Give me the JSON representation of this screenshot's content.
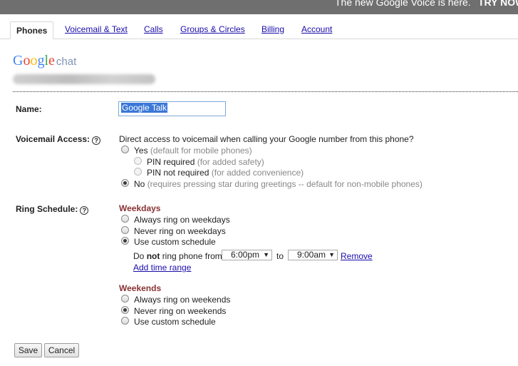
{
  "topbar": {
    "promo_text": "The new Google Voice is here.",
    "promo_cta": "TRY NOW"
  },
  "tabs": [
    {
      "label": "Phones",
      "active": true
    },
    {
      "label": "Voicemail & Text"
    },
    {
      "label": "Calls"
    },
    {
      "label": "Groups & Circles"
    },
    {
      "label": "Billing"
    },
    {
      "label": "Account"
    }
  ],
  "logo": {
    "google": "Google",
    "product": "chat",
    "colors": [
      "#4285f4",
      "#ea4335",
      "#fbbc05",
      "#4285f4",
      "#34a853",
      "#ea4335"
    ]
  },
  "name_field": {
    "label": "Name:",
    "value": "Google Talk"
  },
  "voicemail": {
    "label": "Voicemail Access:",
    "help_icon": "?",
    "question": "Direct access to voicemail when calling your Google number from this phone?",
    "yes_label": "Yes",
    "yes_note": "(default for mobile phones)",
    "pin_required_label": "PIN required",
    "pin_required_note": "(for added safety)",
    "pin_not_required_label": "PIN not required",
    "pin_not_required_note": "(for added convenience)",
    "no_label": "No",
    "no_note": "(requires pressing star during greetings -- default for non-mobile phones)",
    "selected": "no"
  },
  "ring_schedule": {
    "label": "Ring Schedule:",
    "help_icon": "?",
    "weekdays": {
      "title": "Weekdays",
      "options": [
        "Always ring on weekdays",
        "Never ring on weekdays",
        "Use custom schedule"
      ],
      "selected_index": 2,
      "custom": {
        "prefix_do": "Do",
        "prefix_not": "not",
        "prefix_rest": "ring phone from",
        "from_value": "6:00pm",
        "to_label": "to",
        "to_value": "9:00am",
        "remove_label": "Remove",
        "add_range_label": "Add time range"
      }
    },
    "weekends": {
      "title": "Weekends",
      "options": [
        "Always ring on weekends",
        "Never ring on weekends",
        "Use custom schedule"
      ],
      "selected_index": 1
    }
  },
  "buttons": {
    "save": "Save",
    "cancel": "Cancel"
  }
}
